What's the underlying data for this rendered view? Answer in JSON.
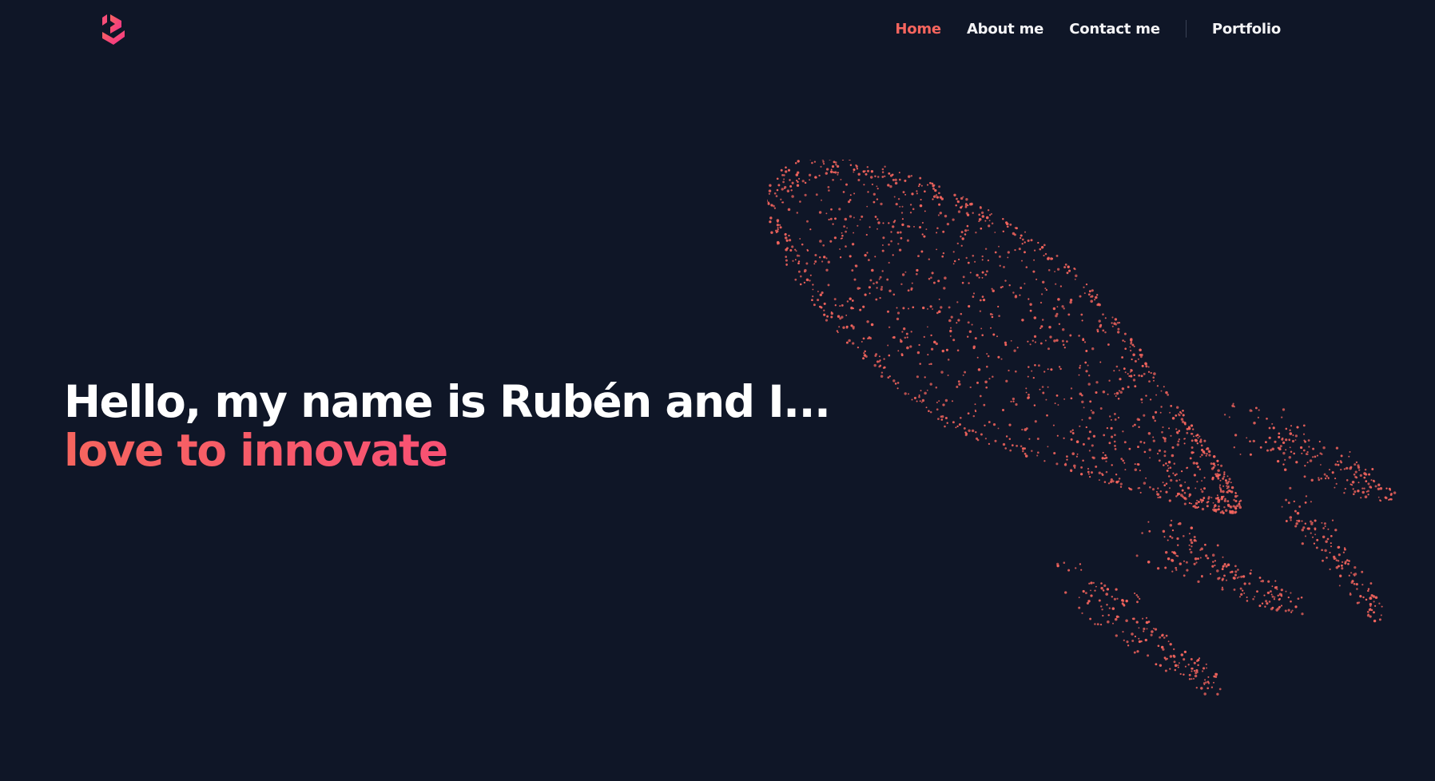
{
  "header": {
    "logo_icon": "r-logo-icon",
    "nav": {
      "home": "Home",
      "about": "About me",
      "contact": "Contact me",
      "portfolio": "Portfolio"
    }
  },
  "hero": {
    "line1": "Hello, my name is Rubén and I...",
    "line2": "love to innovate"
  },
  "colors": {
    "background": "#0f1627",
    "accent": "#f6655e",
    "accent_pink": "#f72f8c",
    "text": "#ffffff"
  },
  "illustration": {
    "icon": "particle-rocket-icon"
  }
}
